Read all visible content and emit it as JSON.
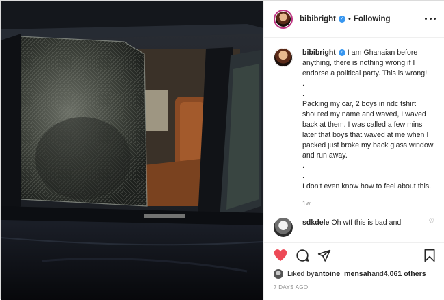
{
  "post": {
    "username": "bibibright",
    "verified_symbol": "✓",
    "separator": "•",
    "follow_status": "Following",
    "caption": {
      "username": "bibibright",
      "text": " I am Ghanaian before anything, there is nothing wrong if I endorse a political party. This is wrong!\n.\n.\nPacking my car, 2 boys in ndc tshirt shouted my name and waved, I waved back at them. I was called a few mins later that boys that waved at me when I packed just broke my back glass window and run away.\n.\n.\nI don't even know how to feel about this.",
      "age": "1w"
    },
    "comment": {
      "username": "sdkdele",
      "text": " Oh wtf this is bad and"
    },
    "likes": {
      "prefix": "Liked by ",
      "user": "antoine_mensah",
      "middle": " and ",
      "count": "4,061 others"
    },
    "time_ago": "7 DAYS AGO",
    "icons": {
      "like": "heart-icon",
      "comment": "comment-icon",
      "share": "share-icon",
      "save": "bookmark-icon",
      "options": "more-options-icon"
    },
    "colors": {
      "heart": "#ed4956",
      "verified": "#3897f0",
      "muted": "#8e8e8e",
      "text": "#262626"
    }
  }
}
